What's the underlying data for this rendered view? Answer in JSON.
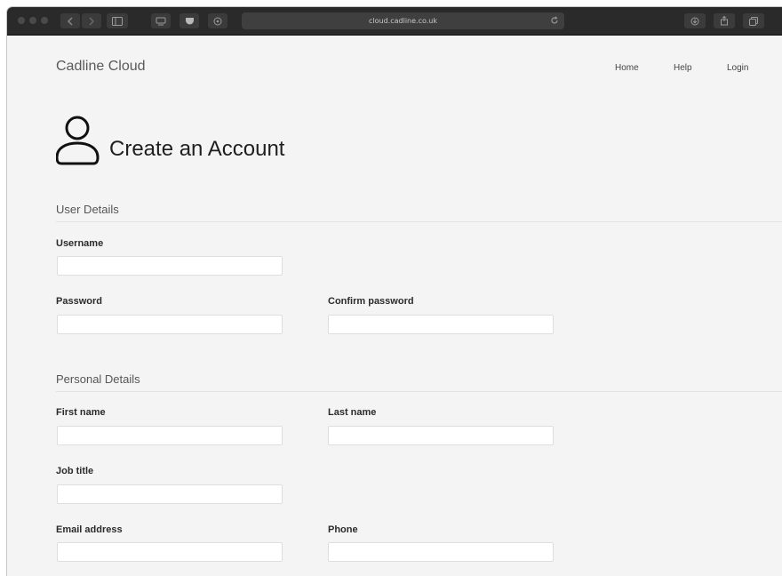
{
  "browser": {
    "address": "cloud.cadline.co.uk",
    "icons": [
      "back-icon",
      "forward-icon",
      "sidebar-icon",
      "tabs-overview-icon",
      "pocket-icon",
      "privacy-shield-icon",
      "reload-icon",
      "download-icon",
      "share-icon",
      "new-tab-icon"
    ]
  },
  "header": {
    "brand": "Cadline Cloud",
    "nav": [
      "Home",
      "Help",
      "Login"
    ]
  },
  "page": {
    "title": "Create an Account",
    "icon": "user-icon"
  },
  "sections": {
    "user_details": {
      "heading": "User Details",
      "username_label": "Username",
      "username_value": "",
      "password_label": "Password",
      "password_value": "",
      "confirm_password_label": "Confirm password",
      "confirm_password_value": ""
    },
    "personal_details": {
      "heading": "Personal Details",
      "first_name_label": "First name",
      "first_name_value": "",
      "last_name_label": "Last name",
      "last_name_value": "",
      "job_title_label": "Job title",
      "job_title_value": "",
      "email_label": "Email address",
      "email_value": "",
      "phone_label": "Phone",
      "phone_value": ""
    }
  },
  "colors": {
    "page_background": "#f4f4f4",
    "toolbar_background": "#2a2a2a",
    "input_background": "#ffffff"
  }
}
